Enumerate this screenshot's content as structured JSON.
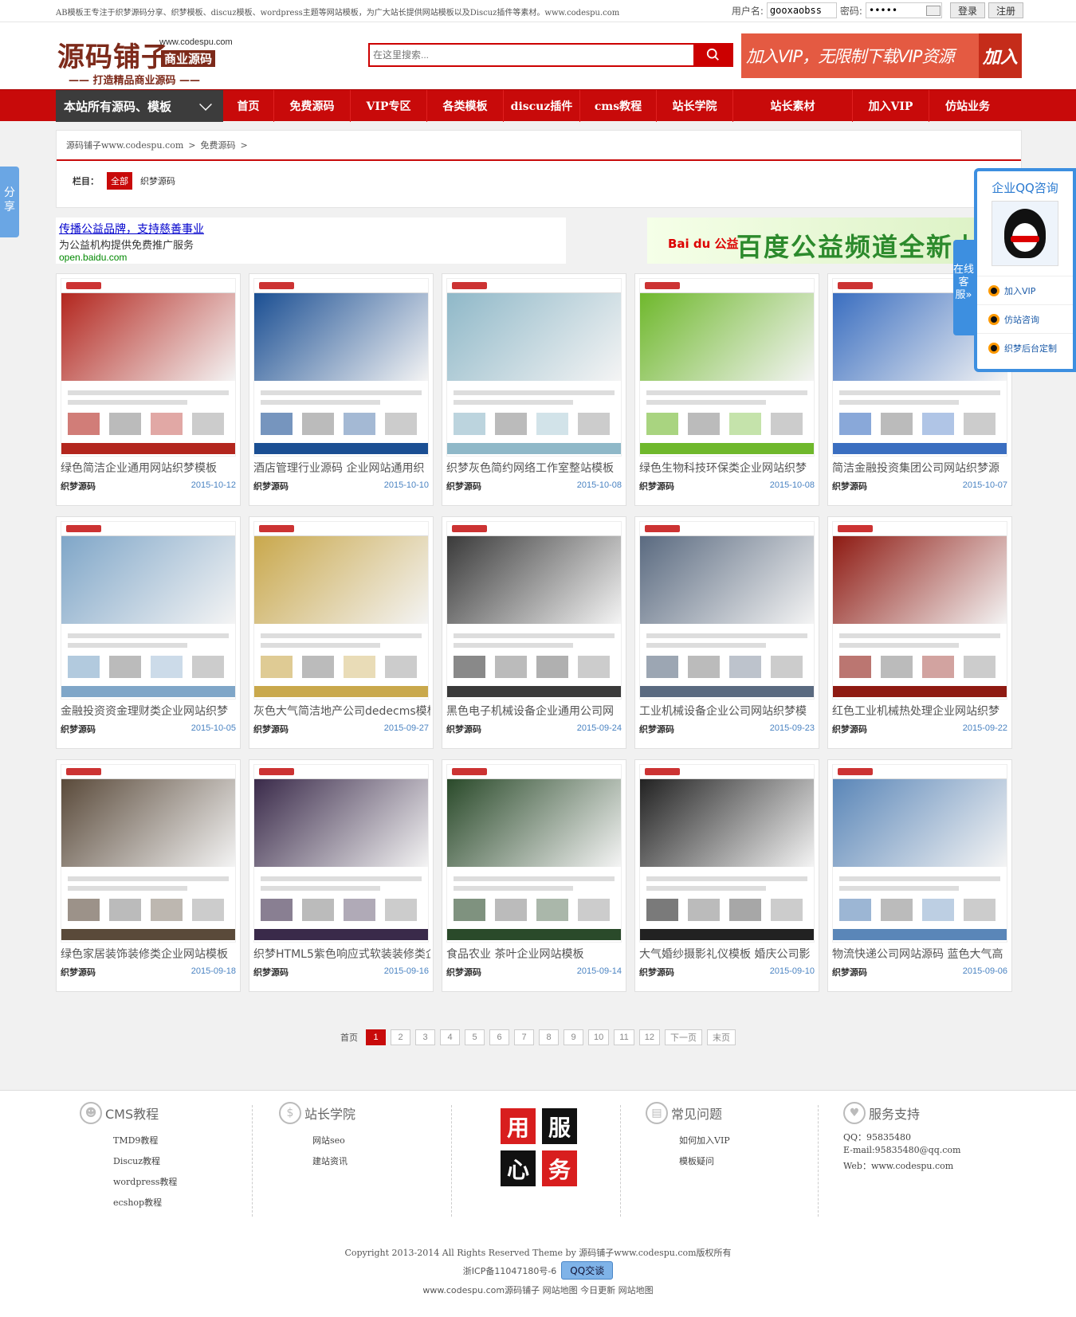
{
  "topbar": {
    "slogan": "AB模板王专注于织梦源码分享、织梦模板、discuz模板、wordpress主题等网站模板，为广大站长提供网站模板以及Discuz插件等素材。www.codespu.com",
    "username_label": "用户名:",
    "username_value": "gooxaobss",
    "password_label": "密码:",
    "password_value": "•••••",
    "login_label": "登录",
    "register_label": "注册"
  },
  "header": {
    "logo_main": "源码铺子",
    "logo_domain": "www.codespu.com",
    "logo_tag": "商业源码",
    "logo_sub": "—— 打造精品商业源码 ——",
    "search_placeholder": "在这里搜索...",
    "vip_text": "加入VIP，无限制下载VIP资源",
    "vip_join": "加入"
  },
  "nav": {
    "category_label": "本站所有源码、模板",
    "items": [
      "首页",
      "免费源码",
      "VIP专区",
      "各类模板",
      "discuz插件",
      "cms教程",
      "站长学院",
      "站长素材",
      "加入VIP",
      "仿站业务"
    ]
  },
  "crumbs": {
    "items": [
      "源码铺子www.codespu.com",
      ">",
      "免费源码",
      ">"
    ],
    "filter_label": "栏目：",
    "filter_all": "全部",
    "filter_option": "织梦源码"
  },
  "share_label": "分享",
  "ads": {
    "ad1_line1": "传播公益品牌，支持慈善事业",
    "ad1_line2": "为公益机构提供免费推广服务",
    "ad1_line3": "open.baidu.com",
    "ad2_brand": "Bai du 公益",
    "ad2_text": "百度公益频道全新上"
  },
  "cards": [
    {
      "title": "绿色简洁企业通用网站织梦模板",
      "category": "织梦源码",
      "date": "2015-10-12",
      "accent": "#b3261e"
    },
    {
      "title": "酒店管理行业源码 企业网站通用织",
      "category": "织梦源码",
      "date": "2015-10-10",
      "accent": "#1b4f93"
    },
    {
      "title": "织梦灰色简约网络工作室整站模板",
      "category": "织梦源码",
      "date": "2015-10-08",
      "accent": "#8fb8c8"
    },
    {
      "title": "绿色生物科技环保类企业网站织梦",
      "category": "织梦源码",
      "date": "2015-10-08",
      "accent": "#6fb82c"
    },
    {
      "title": "简洁金融投资集团公司网站织梦源",
      "category": "织梦源码",
      "date": "2015-10-07",
      "accent": "#3a6ec0"
    },
    {
      "title": "金融投资资金理财类企业网站织梦",
      "category": "织梦源码",
      "date": "2015-10-05",
      "accent": "#7fa6c8"
    },
    {
      "title": "灰色大气简洁地产公司dedecms模板",
      "category": "织梦源码",
      "date": "2015-09-27",
      "accent": "#c9a84c"
    },
    {
      "title": "黑色电子机械设备企业通用公司网",
      "category": "织梦源码",
      "date": "2015-09-24",
      "accent": "#3a3a3a"
    },
    {
      "title": "工业机械设备企业公司网站织梦模",
      "category": "织梦源码",
      "date": "2015-09-23",
      "accent": "#5a6a80"
    },
    {
      "title": "红色工业机械热处理企业网站织梦",
      "category": "织梦源码",
      "date": "2015-09-22",
      "accent": "#8e1a12"
    },
    {
      "title": "绿色家居装饰装修类企业网站模板",
      "category": "织梦源码",
      "date": "2015-09-18",
      "accent": "#5a4a3a"
    },
    {
      "title": "织梦HTML5紫色响应式软装装修类企",
      "category": "织梦源码",
      "date": "2015-09-16",
      "accent": "#3a2a4a"
    },
    {
      "title": "食品农业 茶叶企业网站模板",
      "category": "织梦源码",
      "date": "2015-09-14",
      "accent": "#2a4a2a"
    },
    {
      "title": "大气婚纱摄影礼仪模板 婚庆公司影",
      "category": "织梦源码",
      "date": "2015-09-10",
      "accent": "#222222"
    },
    {
      "title": "物流快递公司网站源码 蓝色大气高",
      "category": "织梦源码",
      "date": "2015-09-06",
      "accent": "#5a86b8"
    }
  ],
  "pager": {
    "first": "首页",
    "pages": [
      "1",
      "2",
      "3",
      "4",
      "5",
      "6",
      "7",
      "8",
      "9",
      "10",
      "11",
      "12"
    ],
    "current": "1",
    "next": "下一页",
    "last": "末页"
  },
  "qq_panel": {
    "title": "企业QQ咨询",
    "tab": "在线客服»",
    "items": [
      "加入VIP",
      "仿站咨询",
      "织梦后台定制"
    ]
  },
  "footer": {
    "col1": {
      "title": "CMS教程",
      "items": [
        "TMD9教程",
        "Discuz教程",
        "wordpress教程",
        "ecshop教程"
      ]
    },
    "col2": {
      "title": "站长学院",
      "items": [
        "网站seo",
        "建站资讯"
      ]
    },
    "grid": [
      "用",
      "服",
      "心",
      "务"
    ],
    "col3": {
      "title": "常见问题",
      "items": [
        "如何加入VIP",
        "模板疑问"
      ]
    },
    "col4": {
      "title": "服务支持",
      "items": [
        "QQ：95835480",
        "E-mail:95835480@qq.com",
        "Web：www.codespu.com"
      ]
    },
    "copyright": "Copyright 2013-2014 All Rights Reserved Theme by 源码铺子www.codespu.com版权所有",
    "icp": "浙ICP备11047180号-6",
    "qq_button": "QQ交谈",
    "links": "www.codespu.com源码铺子  网站地图  今日更新  网站地图"
  }
}
